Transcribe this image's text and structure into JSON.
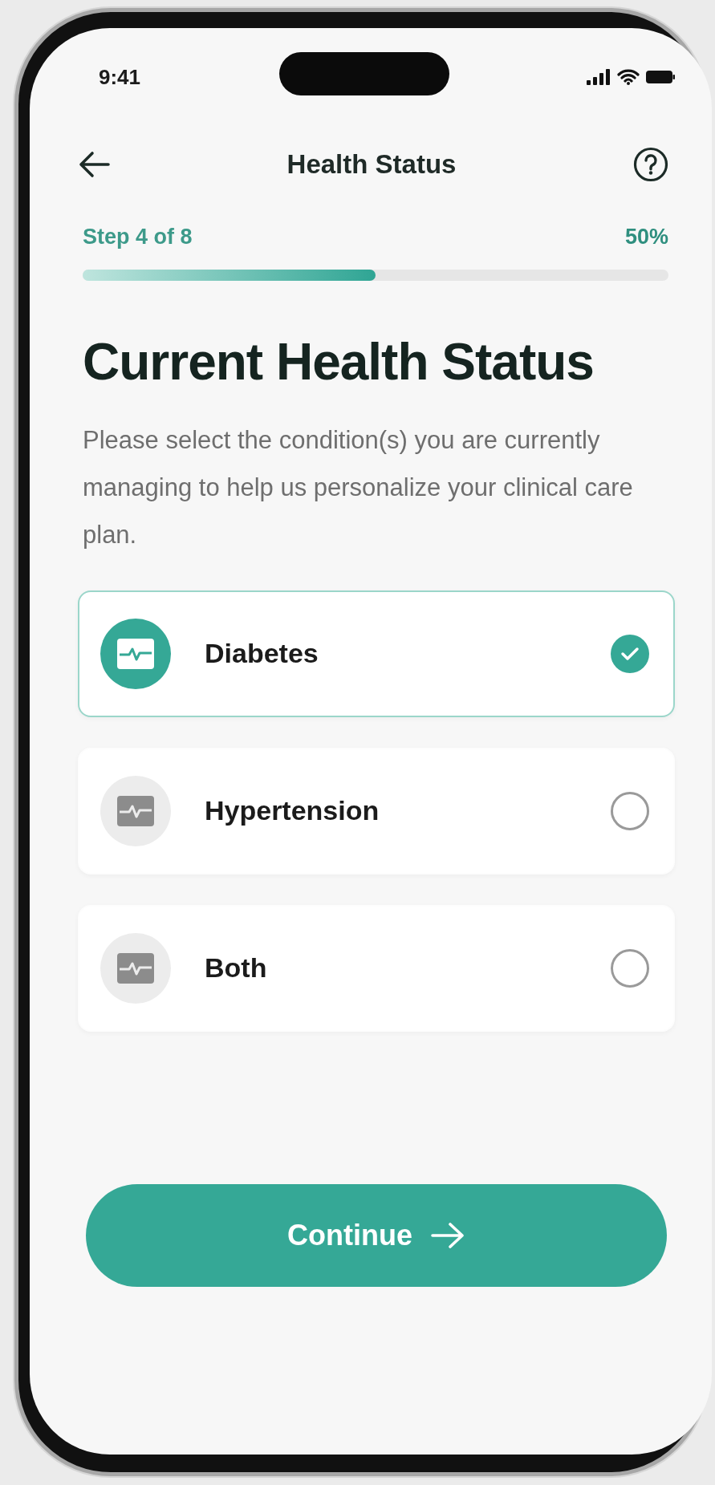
{
  "status_bar": {
    "time": "9:41"
  },
  "header": {
    "title": "Health Status"
  },
  "progress": {
    "step_label": "Step 4 of 8",
    "percent": "50%",
    "level": 0.5
  },
  "heading": "Current Health Status",
  "description": "Please select the condition(s) you are currently managing to help us personalize your clinical care plan.",
  "options": [
    {
      "label": "Diabetes",
      "selected": true
    },
    {
      "label": "Hypertension",
      "selected": false
    },
    {
      "label": "Both",
      "selected": false
    }
  ],
  "button": {
    "label": "Continue"
  }
}
